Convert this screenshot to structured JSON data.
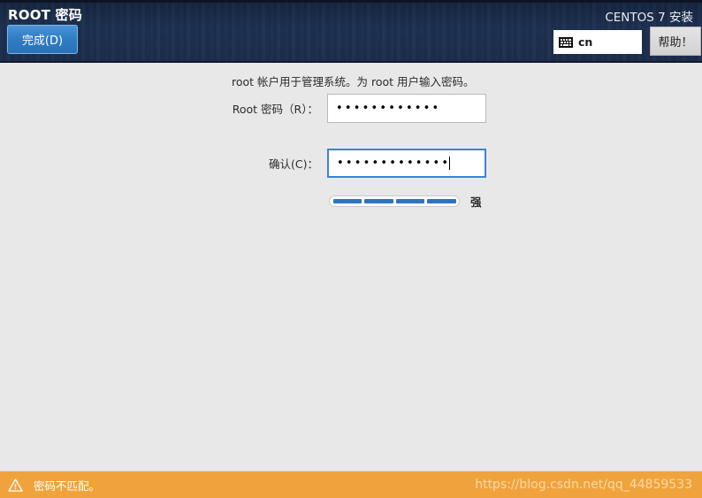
{
  "header": {
    "title": "ROOT 密码",
    "done_label": "完成(D)",
    "product_label": "CENTOS 7 安装",
    "keyboard_layout": "cn",
    "keyboard_icon": "keyboard-icon",
    "help_label": "帮助！"
  },
  "main": {
    "intro_text": "root 帐户用于管理系统。为 root 用户输入密码。",
    "password_field": {
      "label": "Root 密码（R）：",
      "value": "••••••••••••",
      "placeholder": ""
    },
    "confirm_field": {
      "label": "确认(C)：",
      "value": "•••••••••••••",
      "placeholder": ""
    },
    "strength": {
      "label": "强",
      "segments_total": 4,
      "segments_filled": 4
    }
  },
  "status_bar": {
    "icon": "warning-triangle-icon",
    "message": "密码不匹配。",
    "watermark": "https://blog.csdn.net/qq_44859533"
  },
  "colors": {
    "header_bg": "#1d3051",
    "accent_blue": "#2f7cc4",
    "focus_blue": "#3c83d4",
    "warning_orange": "#f0a33c",
    "body_bg": "#e8e8e8"
  }
}
